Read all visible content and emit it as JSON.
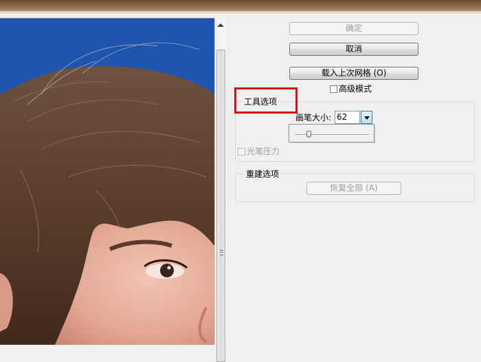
{
  "buttons": {
    "ok_label": "确定",
    "cancel_label": "取消",
    "load_last_mesh_label": "载入上次网格 (O)",
    "restore_all_label": "恢复全部 (A)"
  },
  "advanced_mode_label": "高级模式",
  "tool_options": {
    "title": "工具选项",
    "brush_size_label": "画笔大小:",
    "brush_size_value": "62",
    "stylus_pressure_label": "光笔压力"
  },
  "reconstruct_options": {
    "title": "重建选项"
  },
  "icons": [
    "scroll-up-arrow-icon",
    "scroll-grip-icon",
    "dropdown-arrow-icon",
    "slider-thumb-icon",
    "checkbox-icon"
  ],
  "colors": {
    "highlight_red": "#d40f12",
    "preview_background_blue": "#1f55ad",
    "panel_gray": "#f0f0f0"
  }
}
